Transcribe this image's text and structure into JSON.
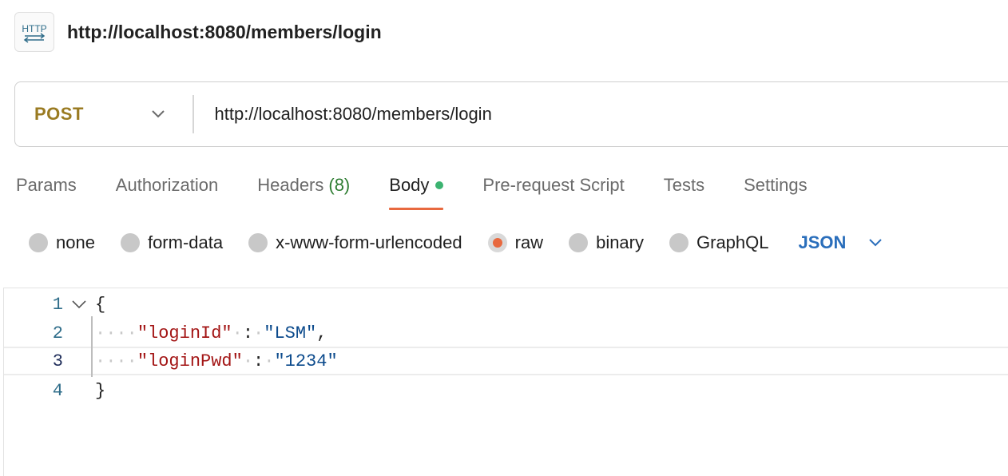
{
  "header": {
    "icon_text": "HTTP",
    "title": "http://localhost:8080/members/login"
  },
  "request": {
    "method": "POST",
    "url": "http://localhost:8080/members/login"
  },
  "tabs": [
    {
      "label": "Params"
    },
    {
      "label": "Authorization"
    },
    {
      "label": "Headers",
      "count": "(8)"
    },
    {
      "label": "Body",
      "active": true
    },
    {
      "label": "Pre-request Script"
    },
    {
      "label": "Tests"
    },
    {
      "label": "Settings"
    }
  ],
  "body_types": [
    {
      "label": "none"
    },
    {
      "label": "form-data"
    },
    {
      "label": "x-www-form-urlencoded"
    },
    {
      "label": "raw",
      "checked": true
    },
    {
      "label": "binary"
    },
    {
      "label": "GraphQL"
    }
  ],
  "language": "JSON",
  "editor": {
    "line_numbers": [
      "1",
      "2",
      "3",
      "4"
    ],
    "open_brace": "{",
    "close_brace": "}",
    "key1": "\"loginId\"",
    "val1": "\"LSM\"",
    "key2": "\"loginPwd\"",
    "val2": "\"1234\"",
    "colon": ":",
    "comma": ",",
    "ws4": "····",
    "ws1": "·"
  },
  "colors": {
    "method": "#9a7b22",
    "active_tab_underline": "#e8693f",
    "body_indicator": "#3cb371",
    "language": "#2a6ebb",
    "json_key": "#a31515",
    "json_string": "#0b4a8c"
  },
  "icons": {
    "http": "http-icon",
    "method_dropdown": "chevron-down-icon",
    "language_dropdown": "chevron-down-icon",
    "fold": "fold-chevron-icon"
  }
}
